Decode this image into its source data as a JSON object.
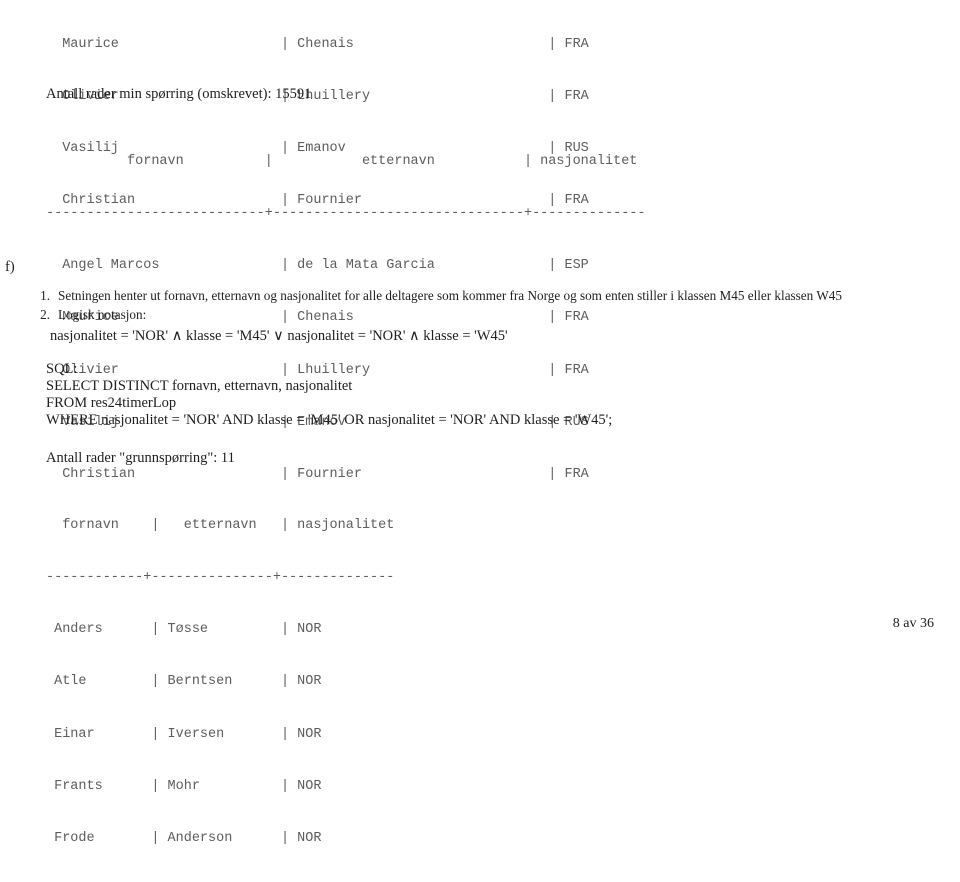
{
  "document": {
    "section_marker": "f)",
    "footer": "8 av 36"
  },
  "top_result_rows": [
    "  Maurice                    | Chenais                        | FRA",
    "  Olivier                    | Lhuillery                      | FRA",
    "  Vasilij                    | Emanov                         | RUS",
    "  Christian                  | Fournier                       | FRA"
  ],
  "count_line_1": "Antall rader min spørring (omskrevet): 15591",
  "second_table": {
    "header": "          fornavn          |           etternavn           | nasjonalitet",
    "separator": "---------------------------+-------------------------------+--------------",
    "rows": [
      "  Angel Marcos               | de la Mata Garcia              | ESP",
      "  Maurice                    | Chenais                        | FRA",
      "  Olivier                    | Lhuillery                      | FRA",
      "  Vasilij                    | Emanov                         | RUS",
      "  Christian                  | Fournier                       | FRA"
    ]
  },
  "tasks": [
    {
      "number": "1.",
      "text": "Setningen henter ut fornavn, etternavn og nasjonalitet for alle deltagere som kommer fra Norge og som enten stiller i klassen M45 eller klassen W45"
    },
    {
      "number": "2.",
      "text": "Logisk notasjon:"
    }
  ],
  "logic_notation": "nasjonalitet = 'NOR' ∧ klasse = 'M45' ∨ nasjonalitet = 'NOR' ∧ klasse = 'W45'",
  "sql": {
    "label": "SQL:",
    "lines": [
      "SELECT DISTINCT fornavn, etternavn, nasjonalitet",
      "FROM res24timerLop",
      "WHERE nasjonalitet = 'NOR' AND klasse = 'M45' OR nasjonalitet = 'NOR' AND klasse = 'W45';"
    ]
  },
  "count_line_2": "Antall rader \"grunnspørring\": 11",
  "third_table": {
    "header": "  fornavn    |   etternavn   | nasjonalitet",
    "separator": "------------+---------------+--------------",
    "rows": [
      " Anders      | Tøsse         | NOR",
      " Atle        | Berntsen      | NOR",
      " Einar       | Iversen       | NOR",
      " Frants      | Mohr          | NOR",
      " Frode       | Anderson      | NOR"
    ]
  }
}
